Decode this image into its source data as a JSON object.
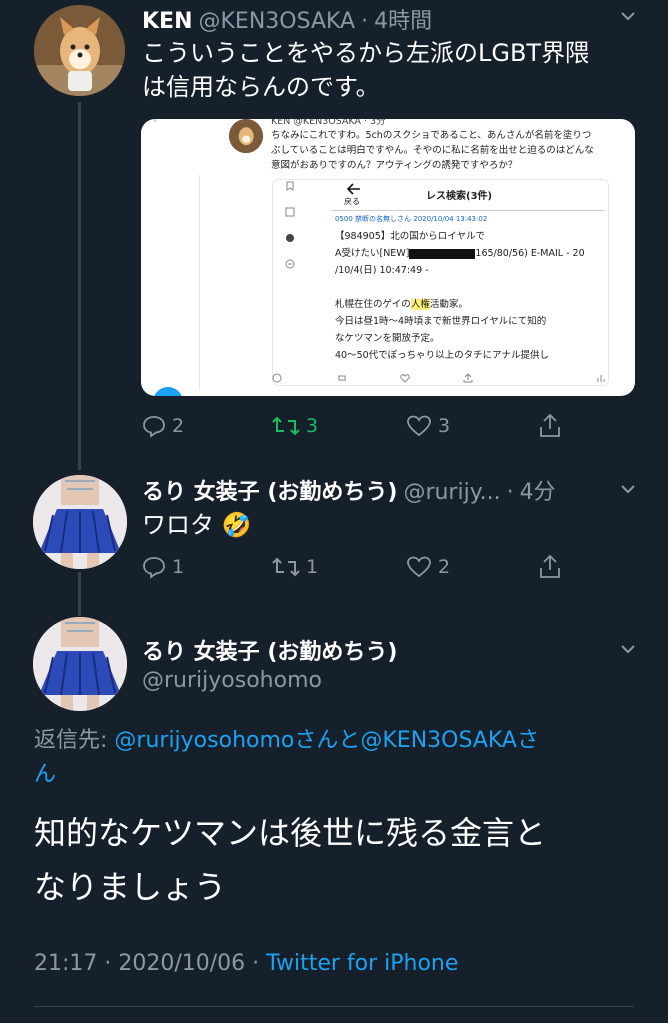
{
  "tweet1": {
    "name": "KEN",
    "handle": "@KEN3OSAKA",
    "time": "4時間",
    "text_line1": "こういうことをやるから左派のLGBT界隈",
    "text_line2": "は信用ならんのです。",
    "reply_count": "2",
    "retweet_count": "3",
    "like_count": "3",
    "embed": {
      "header": "KEN @KEN3OSAKA · 3分",
      "line1": "ちなみにこれですわ。5chのスクショであること、あんさんが名前を塗りつ",
      "line2": "ぶしていることは明白ですやん。そやのに私に名前を出せと迫るのはどんな",
      "line3": "意図がおありですのん？アウティングの誘発ですやろか？",
      "back_label": "戻る",
      "search_title": "レス検索(3件)",
      "post_meta": "0500 禁断の名無しさん 2020/10/04 13:43:02",
      "post_line1": "【984905】北の国からロイヤルで",
      "post_line2a": "A受けたい[NEW]",
      "post_line2b": "165/80/56) E-MAIL - 20",
      "post_line3": "/10/4(日) 10:47:49 -",
      "post_line4a": "札幌在住のゲイの",
      "post_line4b": "人権",
      "post_line4c": "活動家。",
      "post_line5": "今日は昼1時〜4時頃まで新世界ロイヤルにて知的",
      "post_line6": "なケツマンを開放予定。",
      "post_line7": "40〜50代でぽっちゃり以上のタチにアナル提供し"
    }
  },
  "tweet2": {
    "name": "るり 女装子 (お勤めちう)",
    "handle": "@rurijy...",
    "time": "4分",
    "text": "ワロタ",
    "emoji": "🤣",
    "reply_count": "1",
    "retweet_count": "1",
    "like_count": "2"
  },
  "tweet3": {
    "name": "るり 女装子 (お勤めちう)",
    "handle": "@rurijyosohomo",
    "reply_prefix": "返信先: ",
    "reply_to1": "@rurijyosohomo",
    "reply_and": "さんと",
    "reply_to2": "@KEN3OSAKA",
    "reply_suffix1": "さ",
    "reply_suffix2": "ん",
    "text_line1": "知的なケツマンは後世に残る金言と",
    "text_line2": "なりましょう",
    "timestamp": "21:17 · 2020/10/06 · ",
    "source": "Twitter for iPhone"
  },
  "colors": {
    "background": "#15202b",
    "muted": "#8899a6",
    "link": "#1da1f2",
    "retweet_active": "#17bf63"
  }
}
